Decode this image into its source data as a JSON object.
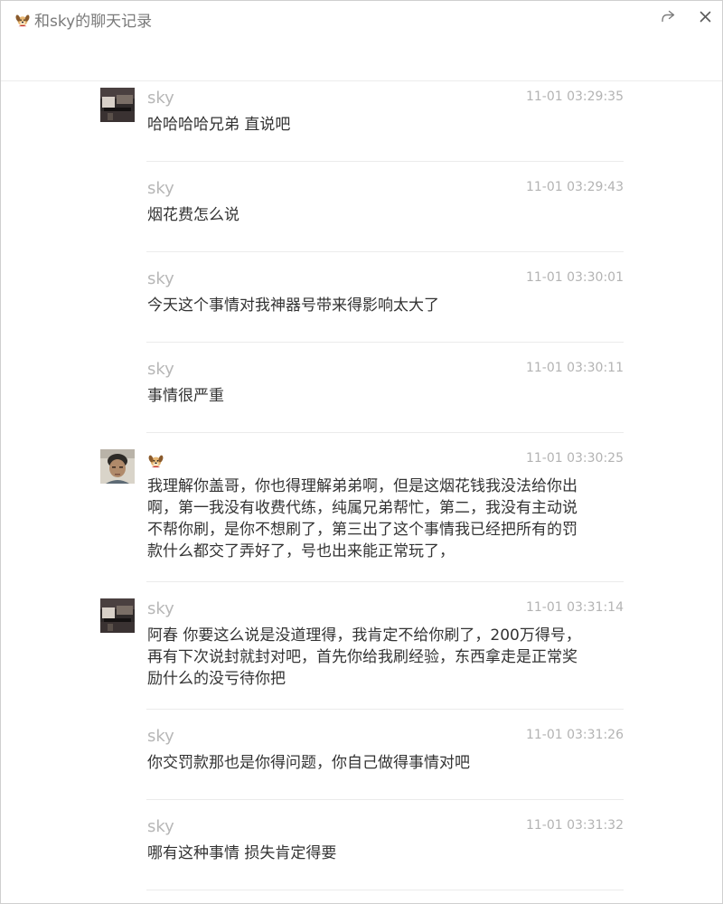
{
  "window": {
    "title": "和sky的聊天记录"
  },
  "icons": {
    "title": "dog-emoji-icon",
    "share": "share-forward-icon",
    "close": "close-icon"
  },
  "messages": [
    {
      "sender": "sky",
      "time": "11-01 03:29:35",
      "text": "哈哈哈哈兄弟 直说吧",
      "avatar": "sky-avatar"
    },
    {
      "sender": "sky",
      "time": "11-01 03:29:43",
      "text": "烟花费怎么说",
      "avatar": ""
    },
    {
      "sender": "sky",
      "time": "11-01 03:30:01",
      "text": "今天这个事情对我神器号带来得影响太大了",
      "avatar": ""
    },
    {
      "sender": "sky",
      "time": "11-01 03:30:11",
      "text": "事情很严重",
      "avatar": ""
    },
    {
      "sender": "",
      "time": "11-01 03:30:25",
      "text": "我理解你盖哥，你也得理解弟弟啊，但是这烟花钱我没法给你出啊，第一我没有收费代练，纯属兄弟帮忙，第二，我没有主动说不帮你刷，是你不想刷了，第三出了这个事情我已经把所有的罚款什么都交了弄好了，号也出来能正常玩了，",
      "avatar": "self-avatar"
    },
    {
      "sender": "sky",
      "time": "11-01 03:31:14",
      "text": "阿春 你要这么说是没道理得，我肯定不给你刷了，200万得号，再有下次说封就封对吧，首先你给我刷经验，东西拿走是正常奖励什么的没亏待你把",
      "avatar": "sky-avatar"
    },
    {
      "sender": "sky",
      "time": "11-01 03:31:26",
      "text": "你交罚款那也是你得问题，你自己做得事情对吧",
      "avatar": ""
    },
    {
      "sender": "sky",
      "time": "11-01 03:31:32",
      "text": "哪有这种事情 损失肯定得要",
      "avatar": ""
    }
  ]
}
